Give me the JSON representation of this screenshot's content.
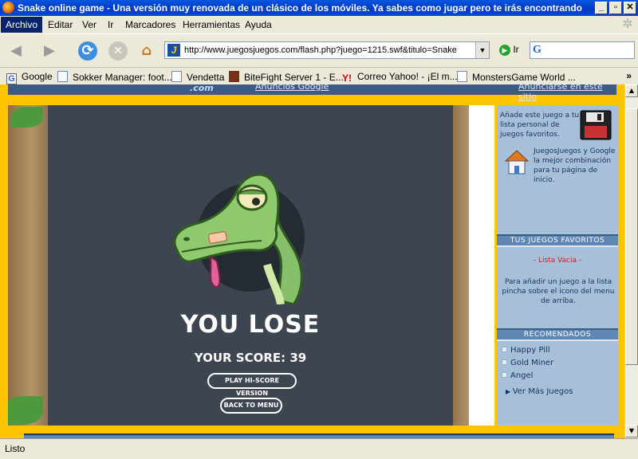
{
  "window": {
    "title": "Snake online game - Una versión muy renovada de un clásico de los móviles. Ya sabes como jugar pero te irás encontrando s...",
    "minimize": "_",
    "maximize": "▫",
    "close": "✕"
  },
  "menu": {
    "items": [
      "Archivo",
      "Editar",
      "Ver",
      "Ir",
      "Marcadores",
      "Herramientas",
      "Ayuda"
    ],
    "active": "Archivo"
  },
  "navbar": {
    "url": "http://www.juegosjuegos.com/flash.php?juego=1215.swf&titulo=Snake",
    "go_label": "Ir",
    "search_value": ""
  },
  "bookmarks": {
    "items": [
      {
        "label": "Google",
        "icon": "google-icon"
      },
      {
        "label": "Sokker Manager: foot...",
        "icon": "page-icon"
      },
      {
        "label": "Vendetta",
        "icon": "page-icon"
      },
      {
        "label": "BiteFight Server 1 - E...",
        "icon": "bitefight-icon"
      },
      {
        "label": "Correo Yahoo! - ¡El m...",
        "icon": "yahoo-icon"
      },
      {
        "label": "MonstersGame World ...",
        "icon": "page-icon"
      }
    ],
    "more": "»"
  },
  "header_strip": {
    "com_text": ".com",
    "ads_google": "Anuncios Google",
    "advertise": "Anunciarse en este sitio"
  },
  "game": {
    "result": "YOU LOSE",
    "score_label": "YOUR SCORE: 39",
    "play_hi_score": "PLAY HI-SCORE VERSION",
    "back_to_menu": "BACK TO MENU"
  },
  "sidebar": {
    "add_favorite": "Añade este juego a tu lista personal de juegos favoritos.",
    "homepage": "JuegosJuegos y Google la mejor combinación para tu página de inicio.",
    "favorites_header": "TUS JUEGOS FAVORITOS",
    "favorites_empty": "- Lista Vacia -",
    "favorites_help": "Para añadir un juego a la lista pincha sobre el icono del menu de arriba.",
    "recommended_header": "RECOMENDADOS",
    "recommended": [
      "Happy Pill",
      "Gold Miner",
      "Angel"
    ],
    "more_games": "Ver Más Juegos"
  },
  "status": {
    "text": "Listo"
  },
  "colors": {
    "page_background": "#ffc400",
    "game_background": "#3d4650",
    "sidebar_background": "#a7c0da",
    "sidebar_header": "#5f87b3",
    "empty_list": "#c81e1e"
  }
}
